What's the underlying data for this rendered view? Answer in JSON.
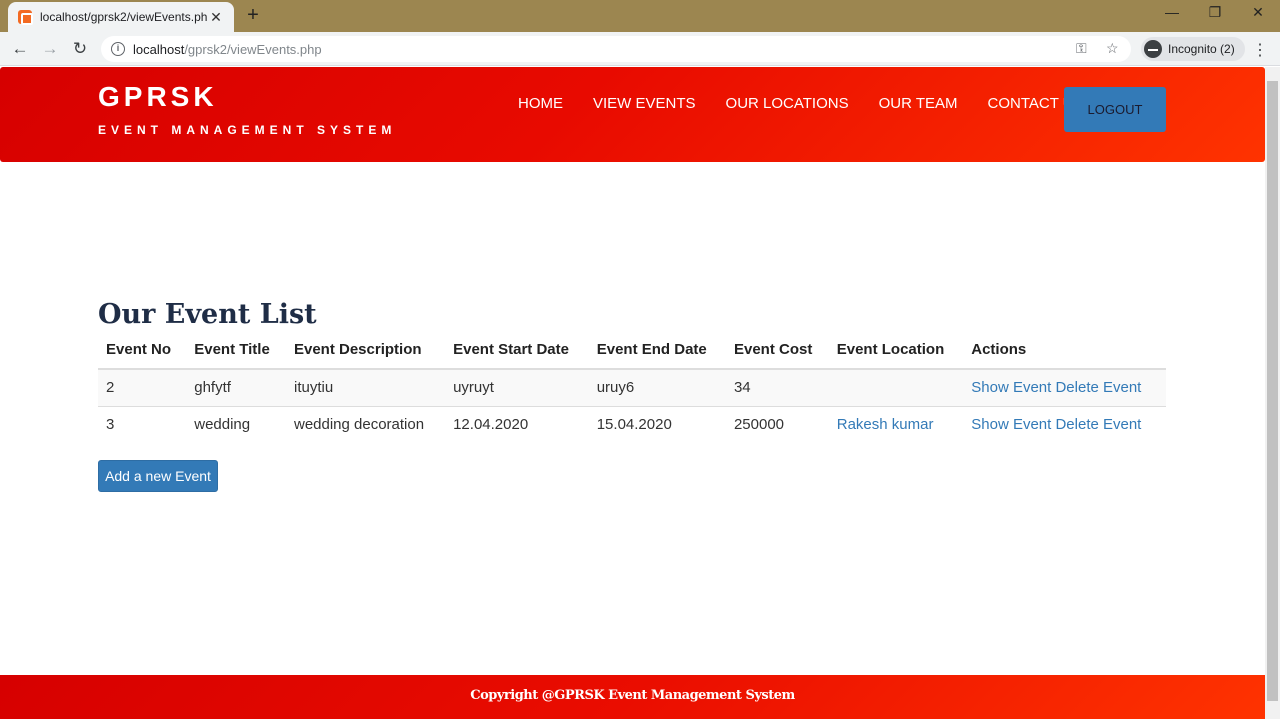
{
  "browser": {
    "tab_title": "localhost/gprsk2/viewEvents.php",
    "tab_close": "✕",
    "new_tab": "+",
    "url_host": "localhost",
    "url_path": "/gprsk2/viewEvents.php",
    "incognito_label": "Incognito (2)",
    "window_controls": {
      "minimize": "—",
      "restore": "❐",
      "close": "✕"
    }
  },
  "header": {
    "brand_title": "GPRSK",
    "brand_subtitle": "EVENT MANAGEMENT SYSTEM",
    "nav": [
      "HOME",
      "VIEW EVENTS",
      "OUR LOCATIONS",
      "OUR TEAM",
      "CONTACT US"
    ],
    "logout_label": "LOGOUT"
  },
  "main": {
    "heading": "Our Event List",
    "columns": [
      "Event No",
      "Event Title",
      "Event Description",
      "Event Start Date",
      "Event End Date",
      "Event Cost",
      "Event Location",
      "Actions"
    ],
    "rows": [
      {
        "no": "2",
        "title": "ghfytf",
        "description": "ituytiu",
        "start": "uyruyt",
        "end": "uruy6",
        "cost": "34",
        "location": "",
        "show": "Show Event",
        "delete": "Delete Event"
      },
      {
        "no": "3",
        "title": "wedding",
        "description": "wedding decoration",
        "start": "12.04.2020",
        "end": "15.04.2020",
        "cost": "250000",
        "location": "Rakesh kumar",
        "show": "Show Event",
        "delete": "Delete Event"
      }
    ],
    "add_button": "Add a new Event"
  },
  "footer": {
    "copyright": "Copyright @GPRSK Event Management System"
  },
  "colors": {
    "header_red": "#e80a00",
    "link_blue": "#337ab7",
    "heading_navy": "#1f2d46"
  }
}
